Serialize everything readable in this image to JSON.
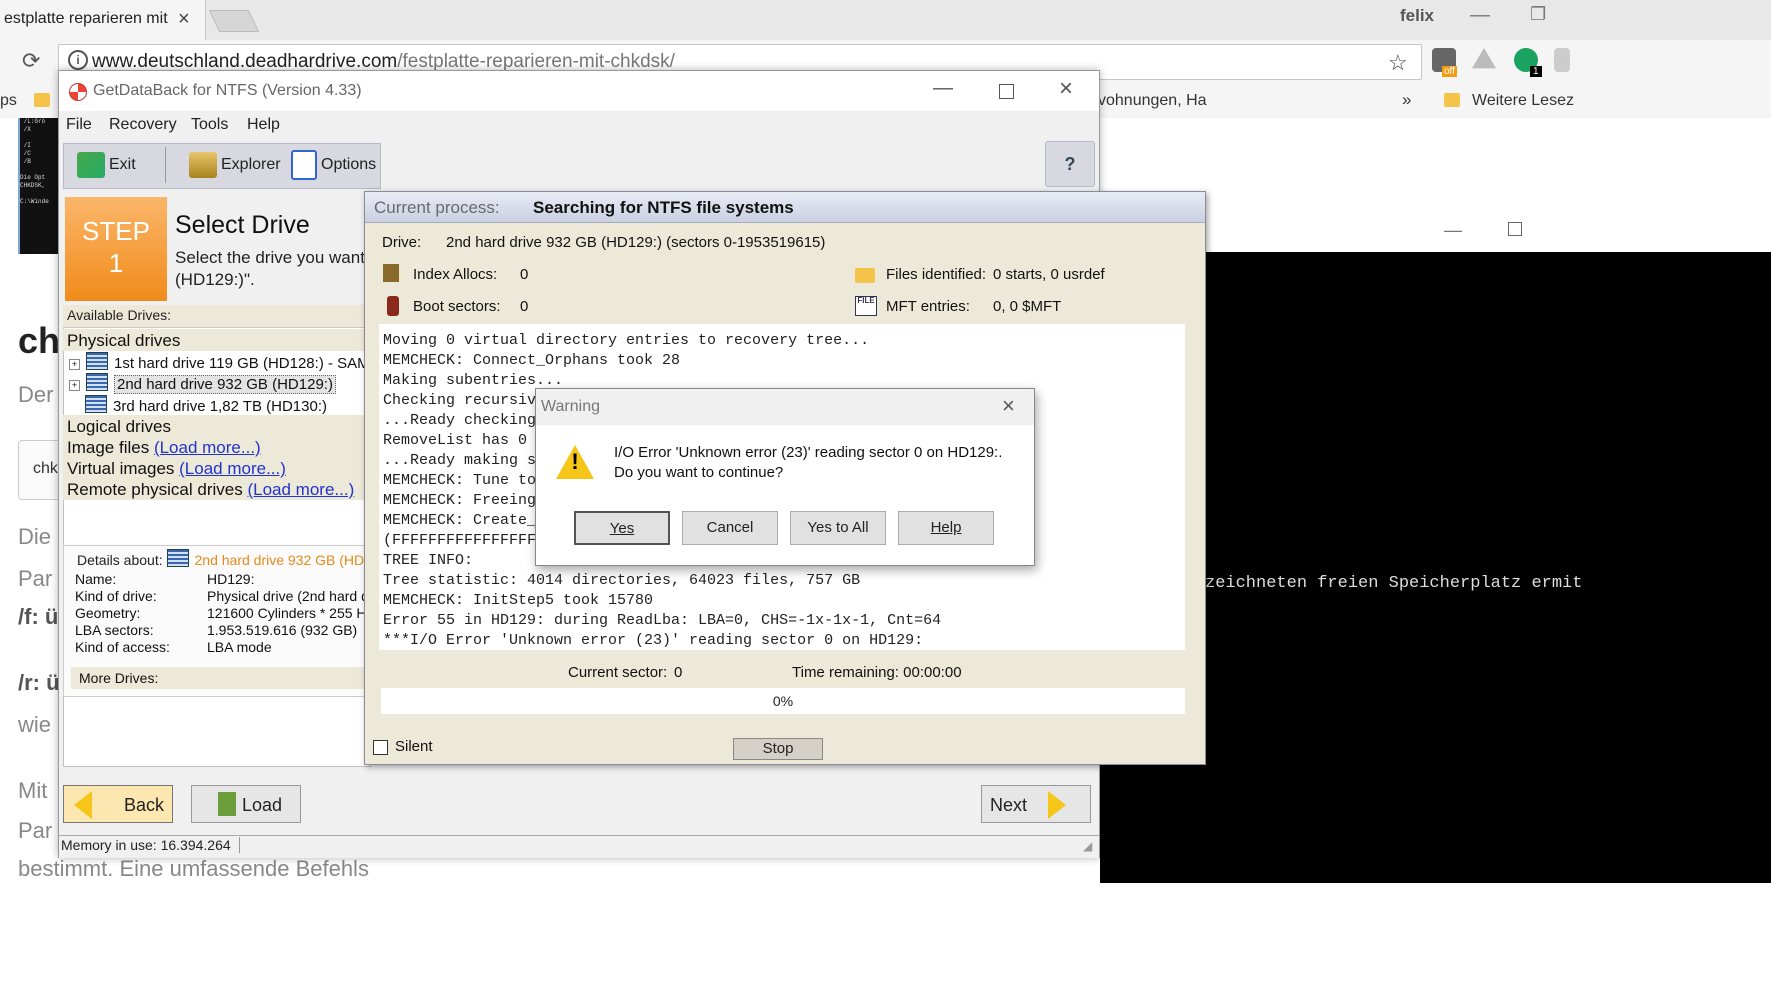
{
  "browser": {
    "tab_title": "estplatte reparieren mit",
    "profile_name": "felix",
    "url_host": "www.deutschland.deadhardrive.com",
    "url_path": "/festplatte-reparieren-mit-chkdsk/",
    "bookmarks": {
      "left_fragment": "ps",
      "middle_fragment": "vohnungen, Ha",
      "overflow": "»",
      "other": "Weitere Lesez"
    },
    "extension_badge_off": "off",
    "extension_badge_count": "1"
  },
  "page": {
    "heading_fragment": "ch",
    "lines": [
      "Der",
      "chk",
      "Die",
      "Par",
      "/f: ü",
      "/r: ü",
      "wie",
      "Mit",
      "Par",
      "bestimmt. Eine umfassende Befehls"
    ],
    "console_text": "zeichneten freien Speicherplatz ermit"
  },
  "app": {
    "title": "GetDataBack for NTFS (Version 4.33)",
    "menu": [
      "File",
      "Recovery",
      "Tools",
      "Help"
    ],
    "toolbar": {
      "exit": "Exit",
      "explorer": "Explorer",
      "options": "Options"
    },
    "help_glyph": "?",
    "step": {
      "label": "STEP",
      "number": "1",
      "title": "Select Drive",
      "desc_line1": "Select the drive you want",
      "desc_line2": "(HD129:)\"."
    },
    "available_drives_label": "Available Drives:",
    "physical_drives": "Physical drives",
    "drives": [
      "1st hard drive 119 GB (HD128:) - SAM",
      "2nd hard drive 932 GB (HD129:)",
      "3rd hard drive 1,82 TB (HD130:)"
    ],
    "logical_drives": "Logical drives",
    "image_files": "Image files",
    "virtual_images": "Virtual images",
    "remote_drives": "Remote physical drives",
    "load_more": "(Load more...)",
    "details_about": "Details about:",
    "details_drive": "2nd hard drive 932 GB (HD",
    "details": [
      {
        "k": "Name:",
        "v": "HD129:"
      },
      {
        "k": "Kind of drive:",
        "v": "Physical drive (2nd hard d"
      },
      {
        "k": "Geometry:",
        "v": "121600 Cylinders * 255 H"
      },
      {
        "k": "LBA sectors:",
        "v": "1.953.519.616 (932 GB)"
      },
      {
        "k": "Kind of access:",
        "v": "LBA mode"
      }
    ],
    "more_drives": "More Drives:",
    "back": "Back",
    "load": "Load",
    "next": "Next",
    "memory": "Memory in use: 16.394.264"
  },
  "process": {
    "label": "Current process:",
    "value": "Searching for NTFS file systems",
    "drive_label": "Drive:",
    "drive_value": "2nd hard drive 932 GB (HD129:) (sectors 0-1953519615)",
    "index_allocs_label": "Index Allocs:",
    "index_allocs_value": "0",
    "boot_sectors_label": "Boot sectors:",
    "boot_sectors_value": "0",
    "files_identified_label": "Files identified:",
    "files_identified_value": "0 starts, 0 usrdef",
    "mft_entries_label": "MFT entries:",
    "mft_entries_value": "0, 0 $MFT",
    "log": [
      "Moving 0 virtual directory entries to recovery tree...",
      "MEMCHECK: Connect_Orphans took 28",
      "Making subentries...",
      "Checking recursiv",
      "...Ready checking",
      "RemoveList has 0",
      "...Ready making s",
      "MEMCHECK: Tune to",
      "MEMCHECK: Freeing",
      "MEMCHECK: Create_",
      "(FFFFFFFFFFFFFFFF",
      "TREE INFO:",
      "Tree statistic: 4014 directories, 64023 files, 757 GB",
      "MEMCHECK: InitStep5 took 15780",
      "Error 55 in HD129: during ReadLba: LBA=0, CHS=-1x-1x-1, Cnt=64",
      "***I/O Error 'Unknown error (23)' reading sector 0 on HD129:"
    ],
    "current_sector_label": "Current sector:",
    "current_sector_value": "0",
    "time_remaining": "Time remaining: 00:00:00",
    "progress_text": "0%",
    "progress_value": 0,
    "silent": "Silent",
    "stop": "Stop"
  },
  "warning": {
    "title": "Warning",
    "line1": "I/O Error 'Unknown error (23)' reading sector 0 on HD129:.",
    "line2": "Do you want to continue?",
    "buttons": {
      "yes": "Yes",
      "cancel": "Cancel",
      "yes_all": "Yes to All",
      "help": "Help"
    }
  }
}
